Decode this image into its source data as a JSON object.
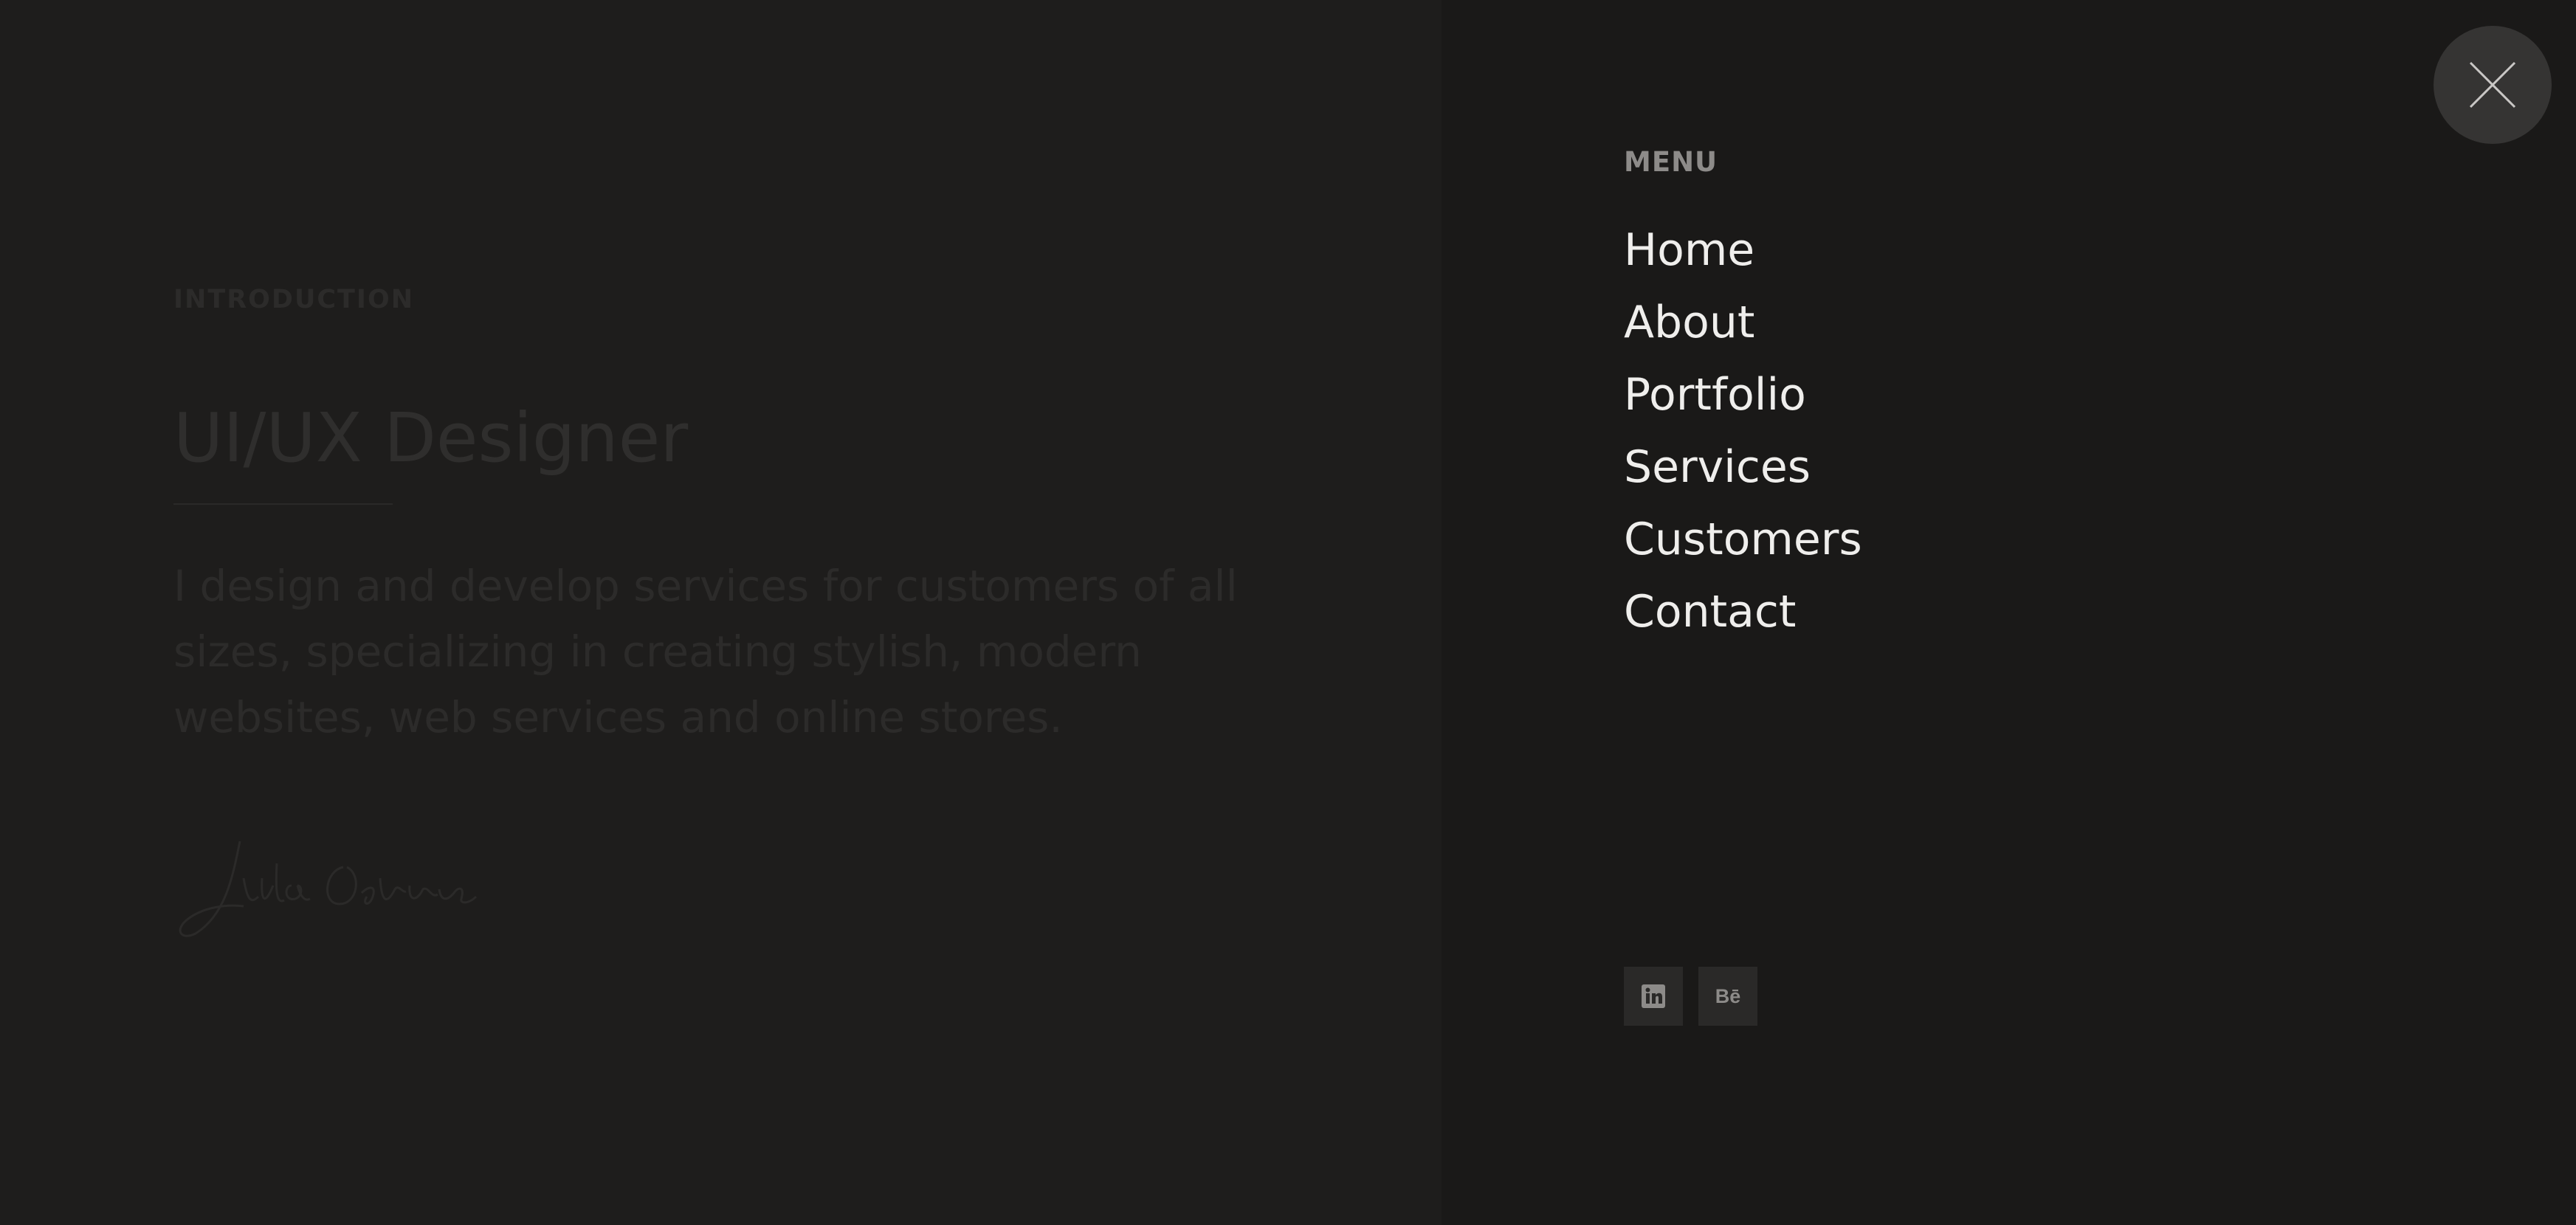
{
  "intro": {
    "label": "INTRODUCTION",
    "title": "UI/UX Designer",
    "description": "I design and develop services for customers of all sizes, specializing in creating stylish, modern websites, web services and online stores.",
    "signature": "Julia Osborn"
  },
  "menu": {
    "heading": "MENU",
    "items": [
      {
        "label": "Home"
      },
      {
        "label": "About"
      },
      {
        "label": "Portfolio"
      },
      {
        "label": "Services"
      },
      {
        "label": "Customers"
      },
      {
        "label": "Contact"
      }
    ]
  },
  "social": {
    "linkedin_icon": "linkedin-icon",
    "behance_label": "Bē"
  },
  "close_icon": "close-icon",
  "colors": {
    "background": "#1d1c1b",
    "panel": "#1a1918",
    "menu_text": "#efeeec",
    "muted": "#8d8b89",
    "button": "#353433"
  }
}
